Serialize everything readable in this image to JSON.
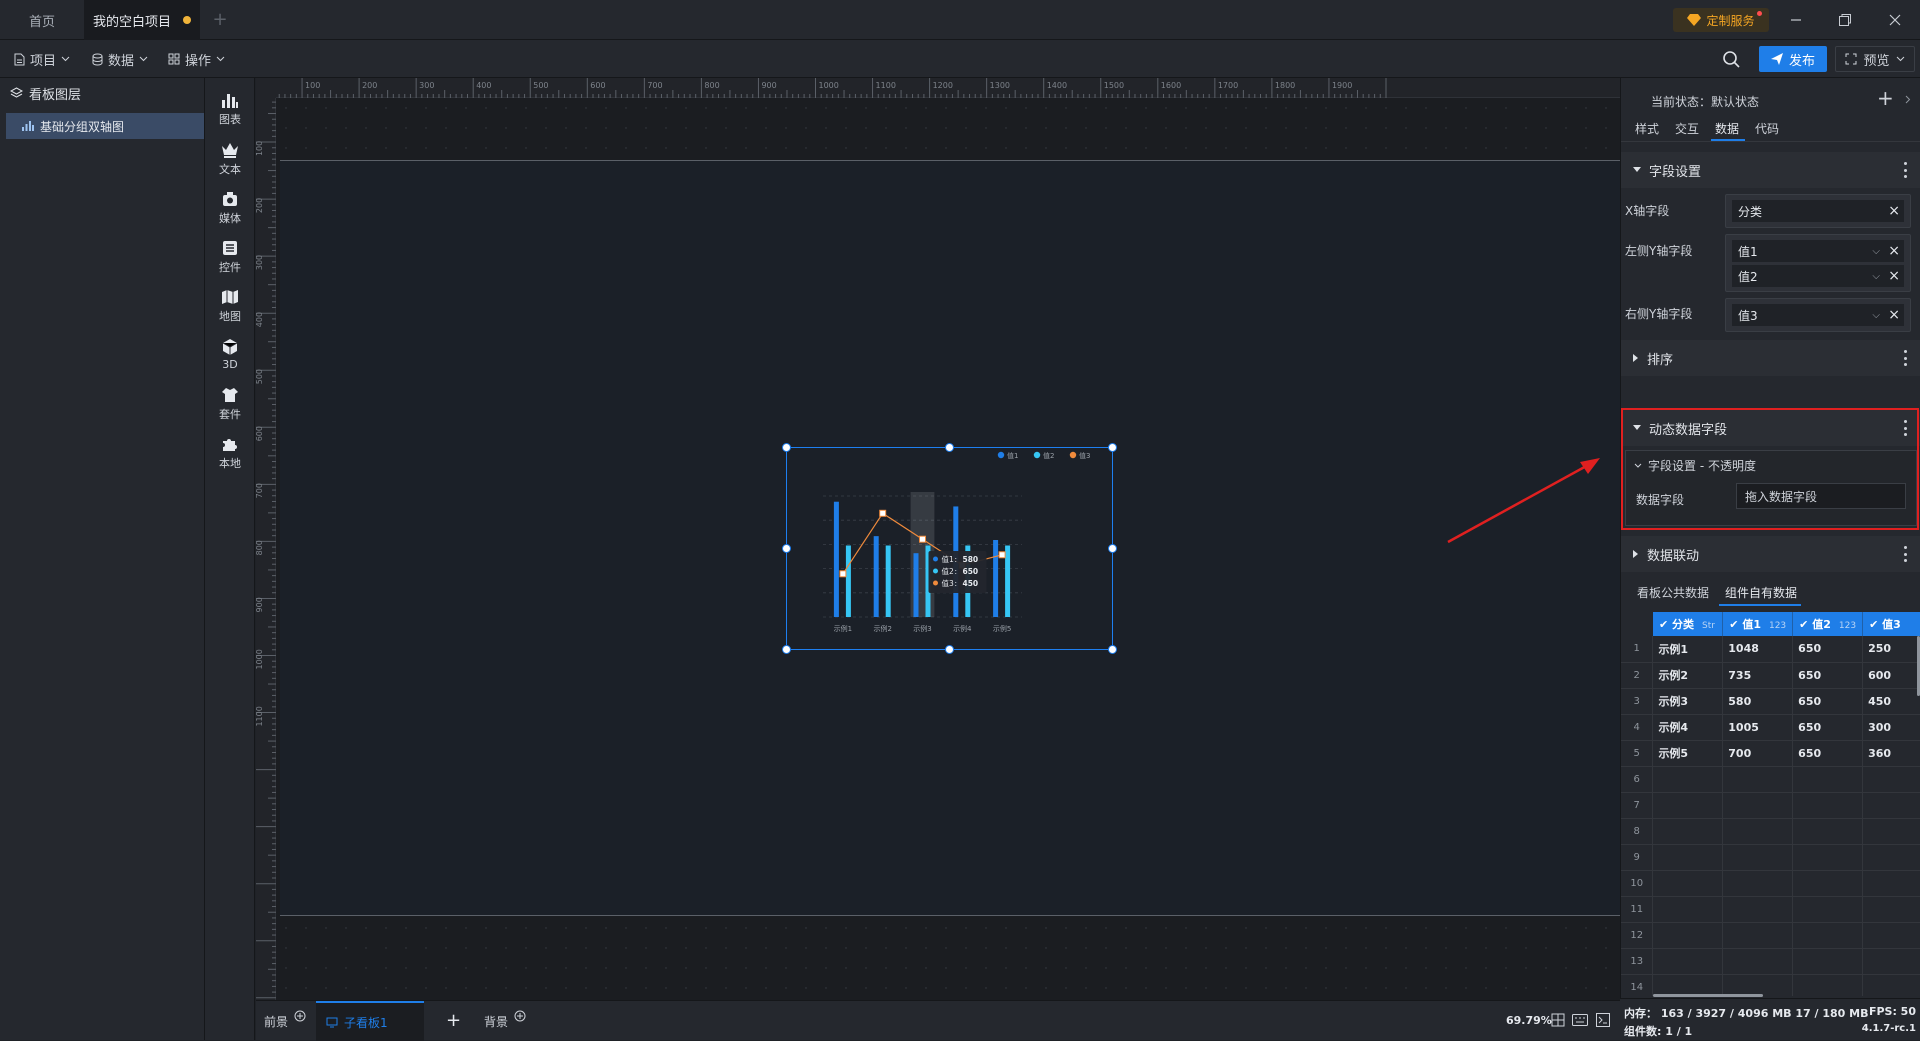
{
  "tabs": [
    {
      "label": "首页",
      "active": false
    },
    {
      "label": "我的空白项目",
      "active": true,
      "unsaved": true
    }
  ],
  "titlebar": {
    "custom_service": "定制服务"
  },
  "menu": {
    "project": "项目",
    "data": "数据",
    "operation": "操作"
  },
  "toolbar": {
    "publish": "发布",
    "preview": "预览"
  },
  "layers": {
    "title": "看板图层",
    "items": [
      {
        "label": "基础分组双轴图",
        "selected": true
      }
    ]
  },
  "components": [
    {
      "label": "图表",
      "icon": "bar-chart-icon"
    },
    {
      "label": "文本",
      "icon": "text-icon"
    },
    {
      "label": "媒体",
      "icon": "media-icon"
    },
    {
      "label": "控件",
      "icon": "control-icon"
    },
    {
      "label": "地图",
      "icon": "map-icon"
    },
    {
      "label": "3D",
      "icon": "cube-icon"
    },
    {
      "label": "套件",
      "icon": "kit-icon"
    },
    {
      "label": "本地",
      "icon": "puzzle-icon"
    }
  ],
  "ruler": {
    "top": [
      "100",
      "200",
      "300",
      "400",
      "500",
      "600",
      "700",
      "800",
      "900",
      "1000",
      "1100",
      "1200",
      "1300",
      "1400",
      "1500",
      "1600",
      "1700",
      "1800",
      "1900"
    ],
    "left": [
      "100",
      "200",
      "300",
      "400",
      "500",
      "600",
      "700",
      "800",
      "900",
      "1000",
      "1100"
    ]
  },
  "chart_data": {
    "type": "bar",
    "categories": [
      "示例1",
      "示例2",
      "示例3",
      "示例4",
      "示例5"
    ],
    "series": [
      {
        "name": "值1",
        "kind": "bar",
        "axis": "left",
        "values": [
          1048,
          735,
          580,
          1005,
          700
        ]
      },
      {
        "name": "值2",
        "kind": "bar",
        "axis": "left",
        "values": [
          650,
          650,
          650,
          650,
          650
        ]
      },
      {
        "name": "值3",
        "kind": "line",
        "axis": "right",
        "values": [
          250,
          600,
          450,
          300,
          360
        ]
      }
    ],
    "legend": "top-right",
    "colors": {
      "值1": "#1f7ee8",
      "值2": "#36c6f4",
      "值3": "#ef8a3c"
    },
    "tooltip": {
      "category": "示例3",
      "rows": [
        {
          "name": "值1",
          "value": "580"
        },
        {
          "name": "值2",
          "value": "650"
        },
        {
          "name": "值3",
          "value": "450"
        }
      ]
    },
    "grid": true
  },
  "bottom": {
    "foreground": "前景",
    "sub_board": "子看板1",
    "background": "背景",
    "zoom": "69.79%"
  },
  "right": {
    "state_label": "当前状态：",
    "state_value": "默认状态",
    "tabs": [
      "样式",
      "交互",
      "数据",
      "代码"
    ],
    "active_tab": "数据",
    "field_settings": "字段设置",
    "x_field_label": "X轴字段",
    "x_field": "分类",
    "left_y_label": "左侧Y轴字段",
    "left_y_fields": [
      "值1",
      "值2"
    ],
    "right_y_label": "右侧Y轴字段",
    "right_y_field": "值3",
    "sort": "排序",
    "dynamic_fields": "动态数据字段",
    "opacity_setting": "字段设置 - 不透明度",
    "data_field_label": "数据字段",
    "data_field_placeholder": "拖入数据字段",
    "linkage": "数据联动",
    "data_tabs": [
      "看板公共数据",
      "组件自有数据"
    ],
    "active_data_tab": "组件自有数据"
  },
  "table": {
    "columns": [
      {
        "name": "分类",
        "type": "Str"
      },
      {
        "name": "值1",
        "type": "123"
      },
      {
        "name": "值2",
        "type": "123"
      },
      {
        "name": "值3",
        "type": ""
      }
    ],
    "rows": [
      [
        "示例1",
        "1048",
        "650",
        "250"
      ],
      [
        "示例2",
        "735",
        "650",
        "600"
      ],
      [
        "示例3",
        "580",
        "650",
        "450"
      ],
      [
        "示例4",
        "1005",
        "650",
        "300"
      ],
      [
        "示例5",
        "700",
        "650",
        "360"
      ]
    ],
    "row_numbers": [
      "1",
      "2",
      "3",
      "4",
      "5",
      "6",
      "7",
      "8",
      "9",
      "10",
      "11",
      "12",
      "13",
      "14"
    ]
  },
  "status": {
    "memory": "内存： 163 / 3927 / 4096 MB  17 / 180 MB",
    "fps": "FPS: 50",
    "components": "组件数: 1 / 1",
    "version": "4.1.7-rc.1"
  }
}
